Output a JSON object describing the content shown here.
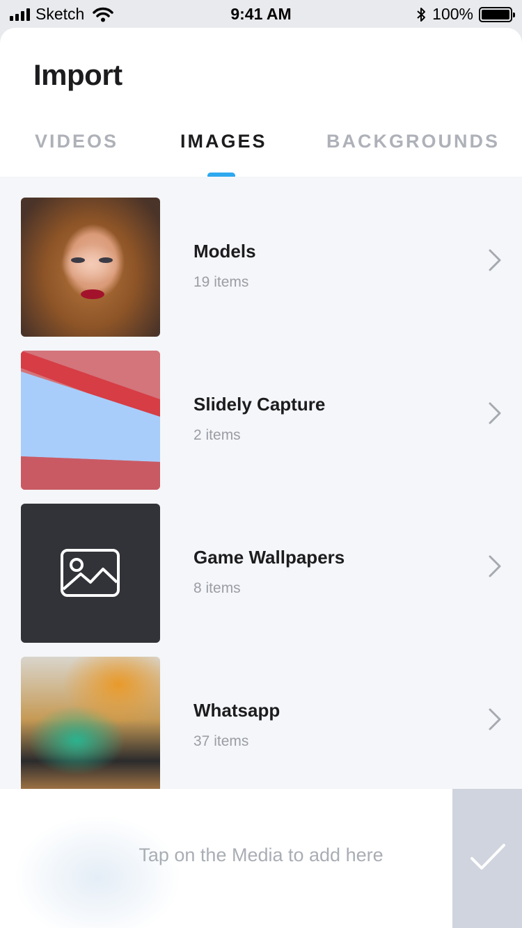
{
  "status_bar": {
    "carrier": "Sketch",
    "time": "9:41 AM",
    "battery": "100%"
  },
  "header": {
    "title": "Import"
  },
  "tabs": [
    {
      "label": "VIDEOS",
      "active": false
    },
    {
      "label": "IMAGES",
      "active": true
    },
    {
      "label": "BACKGROUNDS",
      "active": false
    }
  ],
  "albums": [
    {
      "title": "Models",
      "count": "19 items",
      "thumb": "portrait-photo"
    },
    {
      "title": "Slidely Capture",
      "count": "2 items",
      "thumb": "wall-photo"
    },
    {
      "title": "Game Wallpapers",
      "count": "8 items",
      "thumb": "image-placeholder-icon"
    },
    {
      "title": "Whatsapp",
      "count": "37 items",
      "thumb": "paint-photo"
    }
  ],
  "bottom_bar": {
    "hint": "Tap on the Media to add here",
    "confirm_icon": "checkmark-icon"
  },
  "colors": {
    "accent": "#2ea8ee",
    "list_background": "#f4f6f9",
    "confirm_background": "#d0d4de"
  }
}
